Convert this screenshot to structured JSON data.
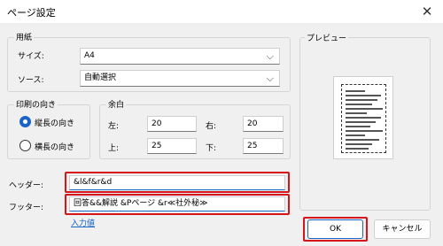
{
  "window": {
    "title": "ページ設定",
    "close_glyph": "✕"
  },
  "paper": {
    "group_label": "用紙",
    "size_label": "サイズ:",
    "size_value": "A4",
    "source_label": "ソース:",
    "source_value": "自動選択"
  },
  "orientation": {
    "group_label": "印刷の向き",
    "portrait_label": "縦長の向き",
    "landscape_label": "横長の向き",
    "selected": "portrait"
  },
  "margins": {
    "group_label": "余白",
    "left_label": "左:",
    "left_value": "20",
    "right_label": "右:",
    "right_value": "20",
    "top_label": "上:",
    "top_value": "25",
    "bottom_label": "下:",
    "bottom_value": "25"
  },
  "header": {
    "label": "ヘッダー:",
    "value": "&l&f&r&d"
  },
  "footer": {
    "label": "フッター:",
    "value": "回答&&解説 &Pページ &r≪社外秘≫"
  },
  "input_values_link": "入力値",
  "preview": {
    "label": "プレビュー"
  },
  "buttons": {
    "ok": "OK",
    "cancel": "キャンセル"
  },
  "colors": {
    "highlight": "#d6141c",
    "accent": "#1a64c8"
  }
}
